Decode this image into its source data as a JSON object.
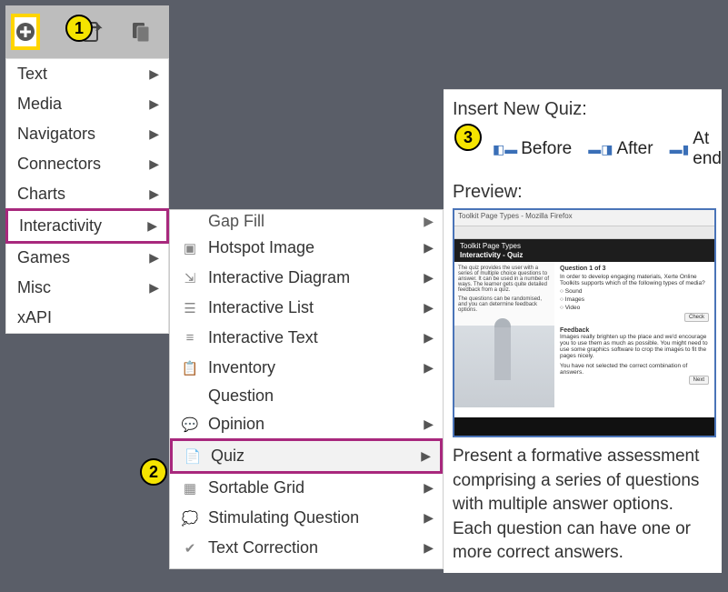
{
  "annotations": {
    "a1": "1",
    "a2": "2",
    "a3": "3"
  },
  "menu": {
    "items": [
      {
        "label": "Text"
      },
      {
        "label": "Media"
      },
      {
        "label": "Navigators"
      },
      {
        "label": "Connectors"
      },
      {
        "label": "Charts"
      },
      {
        "label": "Interactivity"
      },
      {
        "label": "Games"
      },
      {
        "label": "Misc"
      },
      {
        "label": "xAPI"
      }
    ]
  },
  "submenu": {
    "partial_top": "Gap Fill",
    "items": [
      {
        "label": "Hotspot Image"
      },
      {
        "label": "Interactive Diagram"
      },
      {
        "label": "Interactive List"
      },
      {
        "label": "Interactive Text"
      },
      {
        "label": "Inventory"
      }
    ],
    "section_label": "Question",
    "section_items": [
      {
        "label": "Opinion"
      },
      {
        "label": "Quiz"
      },
      {
        "label": "Sortable Grid"
      },
      {
        "label": "Stimulating Question"
      },
      {
        "label": "Text Correction"
      }
    ]
  },
  "panel": {
    "title": "Insert New Quiz:",
    "buttons": {
      "before": "Before",
      "after": "After",
      "atend": "At end"
    },
    "preview_label": "Preview:",
    "preview": {
      "window_title": "Toolkit Page Types - Mozilla Firefox",
      "header_line1": "Toolkit Page Types",
      "header_line2": "Interactivity - Quiz",
      "left_text1": "The quiz provides the user with a series of multiple choice questions to answer. It can be used in a number of ways. The learner gets quite detailed feedback from a quiz.",
      "left_text2": "The questions can be randomised, and you can determine feedback options.",
      "q_title": "Question 1 of 3",
      "q_text": "In order to develop engaging materials, Xerte Online Toolkits supports which of the following types of media?",
      "opt1": "Sound",
      "opt2": "Images",
      "opt3": "Video",
      "btn_check": "Check",
      "fb_title": "Feedback",
      "fb_text": "Images really brighten up the place and we'd encourage you to use them as much as possible. You might need to use some graphics software to crop the images to fit the pages nicely.",
      "fb_text2": "You have not selected the correct combination of answers.",
      "btn_next": "Next"
    },
    "description": "Present a formative assessment comprising a series of questions with multiple answer options. Each question can have one or more correct answers."
  }
}
